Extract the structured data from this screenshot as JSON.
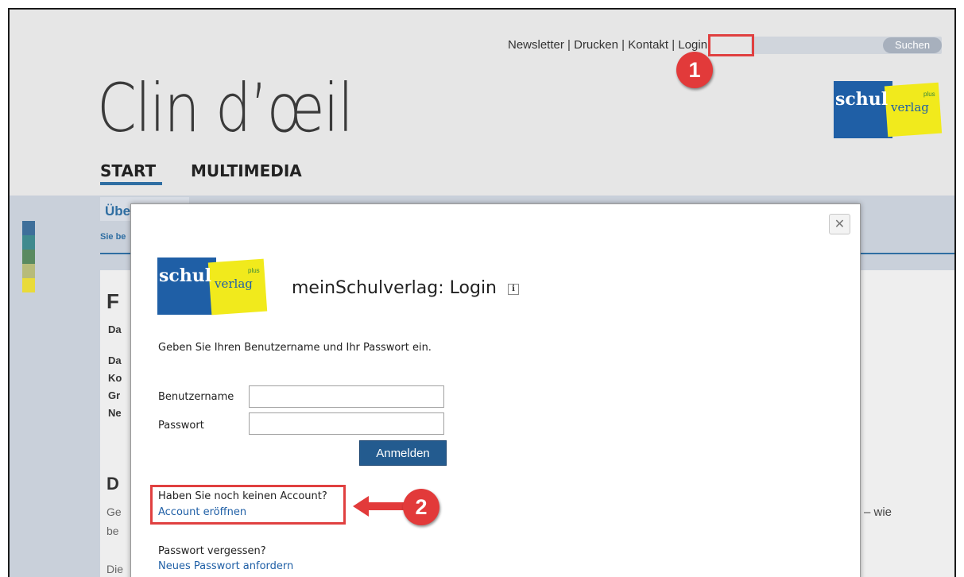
{
  "header": {
    "links": [
      {
        "label": "Newsletter"
      },
      {
        "label": "Drucken"
      },
      {
        "label": "Kontakt"
      },
      {
        "label": "Login"
      }
    ],
    "separator": "|",
    "search_button": "Suchen"
  },
  "site": {
    "title": "Clin d’œil"
  },
  "logo": {
    "schul": "schul",
    "verlag": "verlag",
    "plus": "plus"
  },
  "nav": {
    "items": [
      {
        "label": "START",
        "active": true
      },
      {
        "label": "MULTIMEDIA",
        "active": false
      }
    ]
  },
  "subnav": {
    "tab_label": "Übe",
    "breadcrumb": "Sie be"
  },
  "content": {
    "heading_f": "F",
    "lines": [
      "Da",
      "Da",
      "Ko",
      "Gr",
      "Ne"
    ],
    "heading_d": "D",
    "para_lines": [
      "Ge",
      "be",
      "Die"
    ],
    "wie_text": "– wie"
  },
  "modal": {
    "title": "meinSchulverlag: Login",
    "info_icon": "info-icon",
    "close_symbol": "✕",
    "intro": "Geben Sie Ihren Benutzername und Ihr Passwort ein.",
    "username_label": "Benutzername",
    "password_label": "Passwort",
    "username_value": "",
    "password_value": "",
    "submit_label": "Anmelden",
    "no_account_text": "Haben Sie noch keinen Account?",
    "create_account_link": "Account eröffnen",
    "forgot_text": "Passwort vergessen?",
    "new_password_link": "Neues Passwort anfordern"
  },
  "annotations": {
    "badge_1": "1",
    "badge_2": "2",
    "highlight_color": "#e04040"
  },
  "colors": {
    "brand_blue": "#1f5fa6",
    "brand_yellow": "#f1ea1c",
    "accent": "#2f6ea2",
    "swatches": [
      "#3e6f9a",
      "#3f8a8e",
      "#5a8a60",
      "#b7bb7a",
      "#e9db3a"
    ]
  }
}
